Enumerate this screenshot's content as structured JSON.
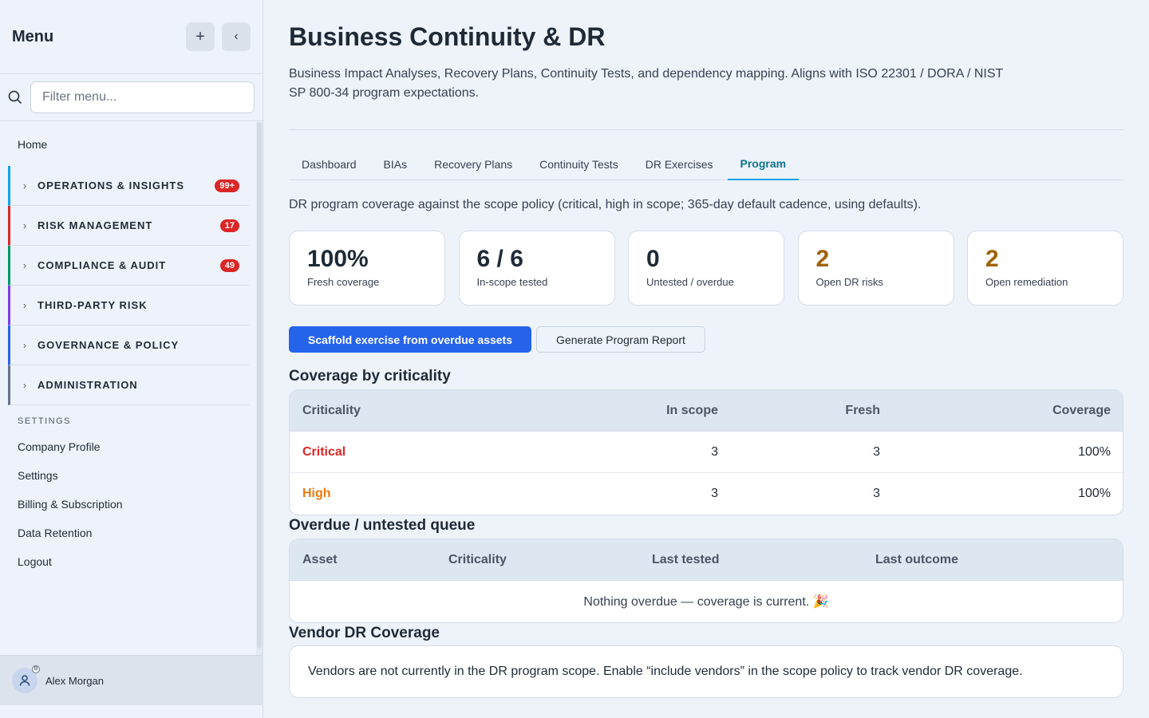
{
  "sidebar": {
    "title": "Menu",
    "add_icon": "plus-icon",
    "collapse_icon": "chevron-left-icon",
    "filter_placeholder": "Filter menu...",
    "home": "Home",
    "groups": [
      {
        "label": "OPERATIONS & INSIGHTS",
        "badge": "99+",
        "color": "#0ea5e9"
      },
      {
        "label": "RISK MANAGEMENT",
        "badge": "17",
        "color": "#dc2626"
      },
      {
        "label": "COMPLIANCE & AUDIT",
        "badge": "49",
        "color": "#059669"
      },
      {
        "label": "THIRD-PARTY RISK",
        "badge": "",
        "color": "#7c3aed"
      },
      {
        "label": "GOVERNANCE & POLICY",
        "badge": "",
        "color": "#2563eb"
      },
      {
        "label": "ADMINISTRATION",
        "badge": "",
        "color": "#64748b"
      }
    ],
    "settings_heading": "SETTINGS",
    "settings_items": [
      "Company Profile",
      "Settings",
      "Billing & Subscription",
      "Data Retention",
      "Logout"
    ],
    "user_name": "Alex Morgan"
  },
  "header": {
    "title": "Business Continuity & DR",
    "description": "Business Impact Analyses, Recovery Plans, Continuity Tests, and dependency mapping. Aligns with ISO 22301 / DORA / NIST SP 800-34 program expectations."
  },
  "tabs": [
    "Dashboard",
    "BIAs",
    "Recovery Plans",
    "Continuity Tests",
    "DR Exercises",
    "Program"
  ],
  "active_tab": "Program",
  "intro": "DR program coverage against the scope policy (critical, high in scope; 365-day default cadence, using defaults).",
  "stats": [
    {
      "value": "100%",
      "label": "Fresh coverage"
    },
    {
      "value": "6 / 6",
      "label": "In-scope tested"
    },
    {
      "value": "0",
      "label": "Untested / overdue"
    },
    {
      "value": "2",
      "label": "Open DR risks"
    },
    {
      "value": "2",
      "label": "Open remediation"
    }
  ],
  "colors": {
    "warn": "#a16207",
    "critical": "#dc2626",
    "high": "#ea7a12",
    "primary": "#2563eb",
    "active_tab": "#0e7490"
  },
  "buttons": {
    "scaffold": "Scaffold exercise from overdue assets",
    "report": "Generate Program Report"
  },
  "coverage": {
    "title": "Coverage by criticality",
    "headers": [
      "Criticality",
      "In scope",
      "Fresh",
      "Coverage"
    ],
    "rows": [
      {
        "criticality": "Critical",
        "in_scope": "3",
        "fresh": "3",
        "coverage": "100%"
      },
      {
        "criticality": "High",
        "in_scope": "3",
        "fresh": "3",
        "coverage": "100%"
      }
    ]
  },
  "overdue": {
    "title": "Overdue / untested queue",
    "headers": [
      "Asset",
      "Criticality",
      "Last tested",
      "Last outcome"
    ],
    "empty": "Nothing overdue — coverage is current. 🎉"
  },
  "vendor": {
    "title": "Vendor DR Coverage",
    "text": "Vendors are not currently in the DR program scope. Enable “include vendors” in the scope policy to track vendor DR coverage."
  }
}
